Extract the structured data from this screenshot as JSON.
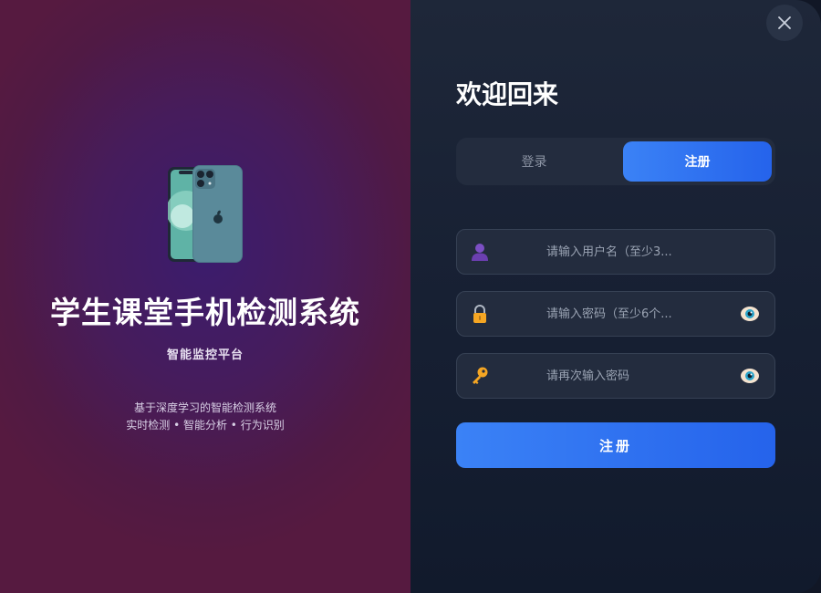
{
  "left_panel": {
    "title": "学生课堂手机检测系统",
    "subtitle": "智能监控平台",
    "description_line1": "基于深度学习的智能检测系统",
    "description_line2": "实时检测 • 智能分析 • 行为识别",
    "logo_icon": "mobile-phone-icon"
  },
  "right_panel": {
    "welcome": "欢迎回来",
    "close_icon": "close-icon",
    "tabs": [
      {
        "label": "登录",
        "active": false
      },
      {
        "label": "注册",
        "active": true
      }
    ],
    "fields": {
      "username": {
        "placeholder": "请输入用户名（至少3...",
        "icon": "user-icon",
        "value": ""
      },
      "password": {
        "placeholder": "请输入密码（至少6个...",
        "icon": "lock-icon",
        "value": ""
      },
      "confirm": {
        "placeholder": "请再次输入密码",
        "icon": "key-icon",
        "value": ""
      }
    },
    "submit_label": "注册"
  },
  "colors": {
    "accent": "#3b82f6",
    "left_background": "#501a44",
    "right_background": "#172033"
  }
}
